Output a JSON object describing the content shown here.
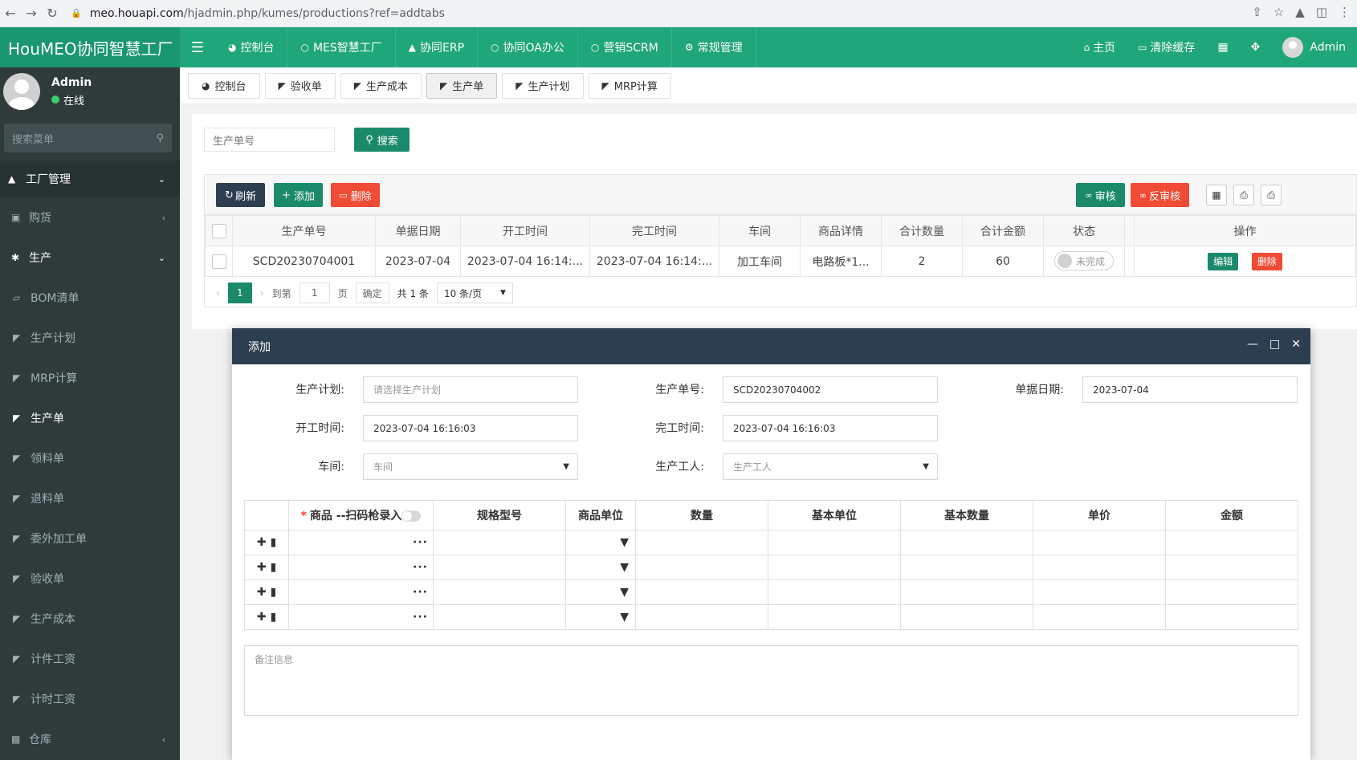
{
  "browser": {
    "url_host": "meo.houapi.com",
    "url_path": "/hjadmin.php/kumes/productions?ref=addtabs"
  },
  "header": {
    "logo": "HouMEO协同智慧工厂",
    "menu": [
      "控制台",
      "MES智慧工厂",
      "协同ERP",
      "协同OA办公",
      "营销SCRM",
      "常规管理"
    ],
    "right": {
      "home": "主页",
      "clear_cache": "清除缓存",
      "user": "Admin"
    }
  },
  "sidebar": {
    "user_name": "Admin",
    "user_status": "在线",
    "search_placeholder": "搜索菜单",
    "group": "工厂管理",
    "items": [
      "购货",
      "生产",
      "BOM清单",
      "生产计划",
      "MRP计算",
      "生产单",
      "领料单",
      "退料单",
      "委外加工单",
      "验收单",
      "生产成本",
      "计件工资",
      "计时工资",
      "仓库"
    ]
  },
  "tabs": [
    "控制台",
    "验收单",
    "生产成本",
    "生产单",
    "生产计划",
    "MRP计算"
  ],
  "list": {
    "search_placeholder": "生产单号",
    "search_btn": "搜索",
    "refresh": "刷新",
    "add": "添加",
    "delete": "删除",
    "audit": "审核",
    "unaudit": "反审核",
    "columns": [
      "生产单号",
      "单据日期",
      "开工时间",
      "完工时间",
      "车间",
      "商品详情",
      "合计数量",
      "合计金额",
      "状态",
      "操作"
    ],
    "row": {
      "no": "SCD20230704001",
      "date": "2023-07-04",
      "start": "2023-07-04 16:14:...",
      "end": "2023-07-04 16:14:...",
      "workshop": "加工车间",
      "detail": "电路板*1...",
      "qty": "2",
      "amount": "60",
      "status": "未完成",
      "edit": "编辑",
      "del": "删除"
    },
    "pager": {
      "page": "1",
      "goto": "到第",
      "page_input": "1",
      "page_unit": "页",
      "confirm": "确定",
      "total": "共 1 条",
      "per_page": "10 条/页"
    }
  },
  "modal": {
    "title": "添加",
    "fields": {
      "plan_label": "生产计划:",
      "plan_placeholder": "请选择生产计划",
      "no_label": "生产单号:",
      "no_value": "SCD20230704002",
      "date_label": "单据日期:",
      "date_value": "2023-07-04",
      "start_label": "开工时间:",
      "start_value": "2023-07-04 16:16:03",
      "end_label": "完工时间:",
      "end_value": "2023-07-04 16:16:03",
      "workshop_label": "车间:",
      "workshop_placeholder": "车间",
      "worker_label": "生产工人:",
      "worker_placeholder": "生产工人"
    },
    "detail_columns": [
      "商品 --扫码枪录入",
      "规格型号",
      "商品单位",
      "数量",
      "基本单位",
      "基本数量",
      "单价",
      "金额"
    ],
    "remark_placeholder": "备注信息"
  }
}
